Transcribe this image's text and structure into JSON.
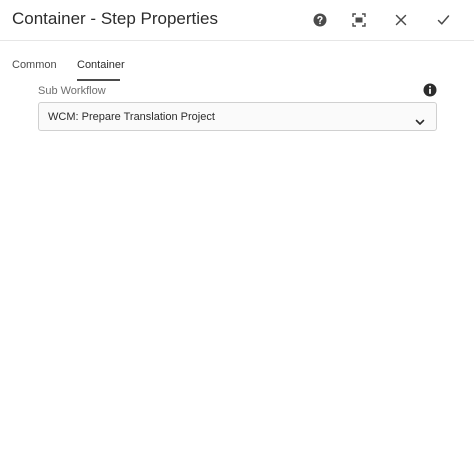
{
  "dialog": {
    "title": "Container - Step Properties",
    "header_buttons": [
      {
        "name": "help",
        "icon": "help-icon"
      },
      {
        "name": "fullscreen",
        "icon": "fullscreen-icon"
      },
      {
        "name": "close",
        "icon": "close-icon"
      },
      {
        "name": "done",
        "icon": "checkmark-icon"
      }
    ]
  },
  "tabs": [
    {
      "label": "Common",
      "active": false
    },
    {
      "label": "Container",
      "active": true
    }
  ],
  "form": {
    "sub_workflow": {
      "label": "Sub Workflow",
      "value": "WCM: Prepare Translation Project",
      "info_icon": "info-icon",
      "dropdown_icon": "chevron-down-icon"
    }
  },
  "colors": {
    "icon": "#4b4b4b",
    "text": "#2c2c2c",
    "border": "#d0d0d0"
  }
}
